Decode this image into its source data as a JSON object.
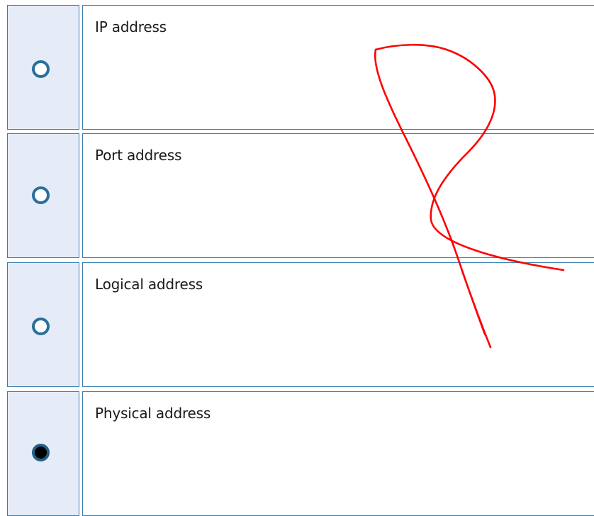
{
  "options": [
    {
      "label": "IP address",
      "selected": false
    },
    {
      "label": "Port address",
      "selected": false
    },
    {
      "label": "Logical address",
      "selected": false
    },
    {
      "label": "Physical address",
      "selected": true
    }
  ],
  "colors": {
    "accent_border": "#3a7fb0",
    "radio_cell_background": "#e5ecf7",
    "annotation_ink": "#ff0000"
  }
}
